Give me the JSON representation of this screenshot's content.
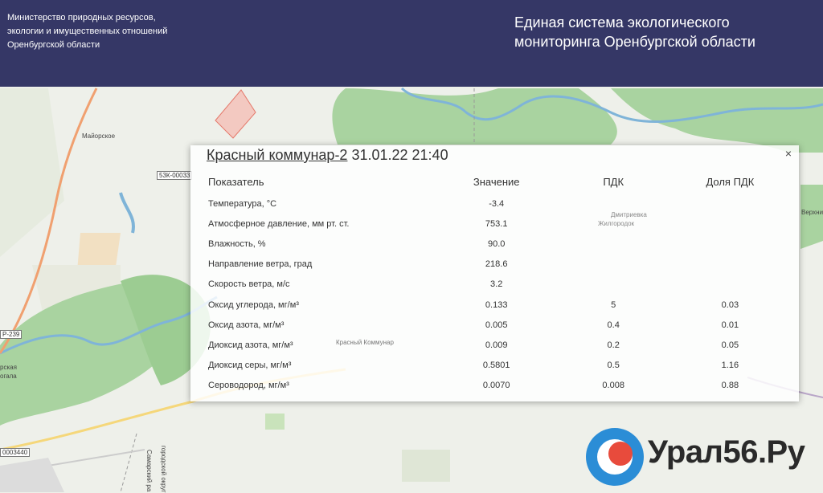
{
  "header": {
    "ministry_lines": [
      "Министерство природных ресурсов,",
      "экологии и имущественных отношений",
      "Оренбургской области"
    ],
    "system_title_lines": [
      "Единая система экологического",
      "мониторинга Оренбургской области"
    ]
  },
  "map": {
    "labels": {
      "mayorskoe": "Майорское",
      "krasny_kommunar": "Красный Коммунар",
      "dmitrievka": "Дмитриевка",
      "zhiltgorodok": "Жилгородок",
      "verkhn": "Верхни",
      "krasnaya": "рская",
      "ogala": "огала",
      "samara_road": "Самарский ра",
      "gorodskoy": "городской округ"
    },
    "road_signs": {
      "r239": "Р-239",
      "k53": "53К-00033",
      "k3440": "0003440"
    }
  },
  "popup": {
    "station": "Красный коммунар-2",
    "datetime": "31.01.22 21:40",
    "close_label": "×",
    "columns": [
      "Показатель",
      "Значение",
      "ПДК",
      "Доля ПДК"
    ],
    "rows": [
      {
        "param": "Температура, °C",
        "value": "-3.4",
        "pdk": "",
        "share": ""
      },
      {
        "param": "Атмосферное давление, мм рт. ст.",
        "value": "753.1",
        "pdk": "",
        "share": ""
      },
      {
        "param": "Влажность, %",
        "value": "90.0",
        "pdk": "",
        "share": ""
      },
      {
        "param": "Направление ветра, град",
        "value": "218.6",
        "pdk": "",
        "share": ""
      },
      {
        "param": "Скорость ветра, м/с",
        "value": "3.2",
        "pdk": "",
        "share": ""
      },
      {
        "param": "Оксид углерода, мг/м³",
        "value": "0.133",
        "pdk": "5",
        "share": "0.03"
      },
      {
        "param": "Оксид азота, мг/м³",
        "value": "0.005",
        "pdk": "0.4",
        "share": "0.01"
      },
      {
        "param": "Диоксид азота, мг/м³",
        "value": "0.009",
        "pdk": "0.2",
        "share": "0.05"
      },
      {
        "param": "Диоксид серы, мг/м³",
        "value": "0.5801",
        "pdk": "0.5",
        "share": "1.16"
      },
      {
        "param": "Сероводород, мг/м³",
        "value": "0.0070",
        "pdk": "0.008",
        "share": "0.88"
      }
    ]
  },
  "watermark": {
    "text": "Урал56.Ру"
  },
  "colors": {
    "header_bg": "#353766",
    "forest": "#a9d3a0",
    "river": "#7fb4d8",
    "road": "#f0a070",
    "logo_blue": "#2b8dd6",
    "logo_red": "#e84b3c"
  }
}
